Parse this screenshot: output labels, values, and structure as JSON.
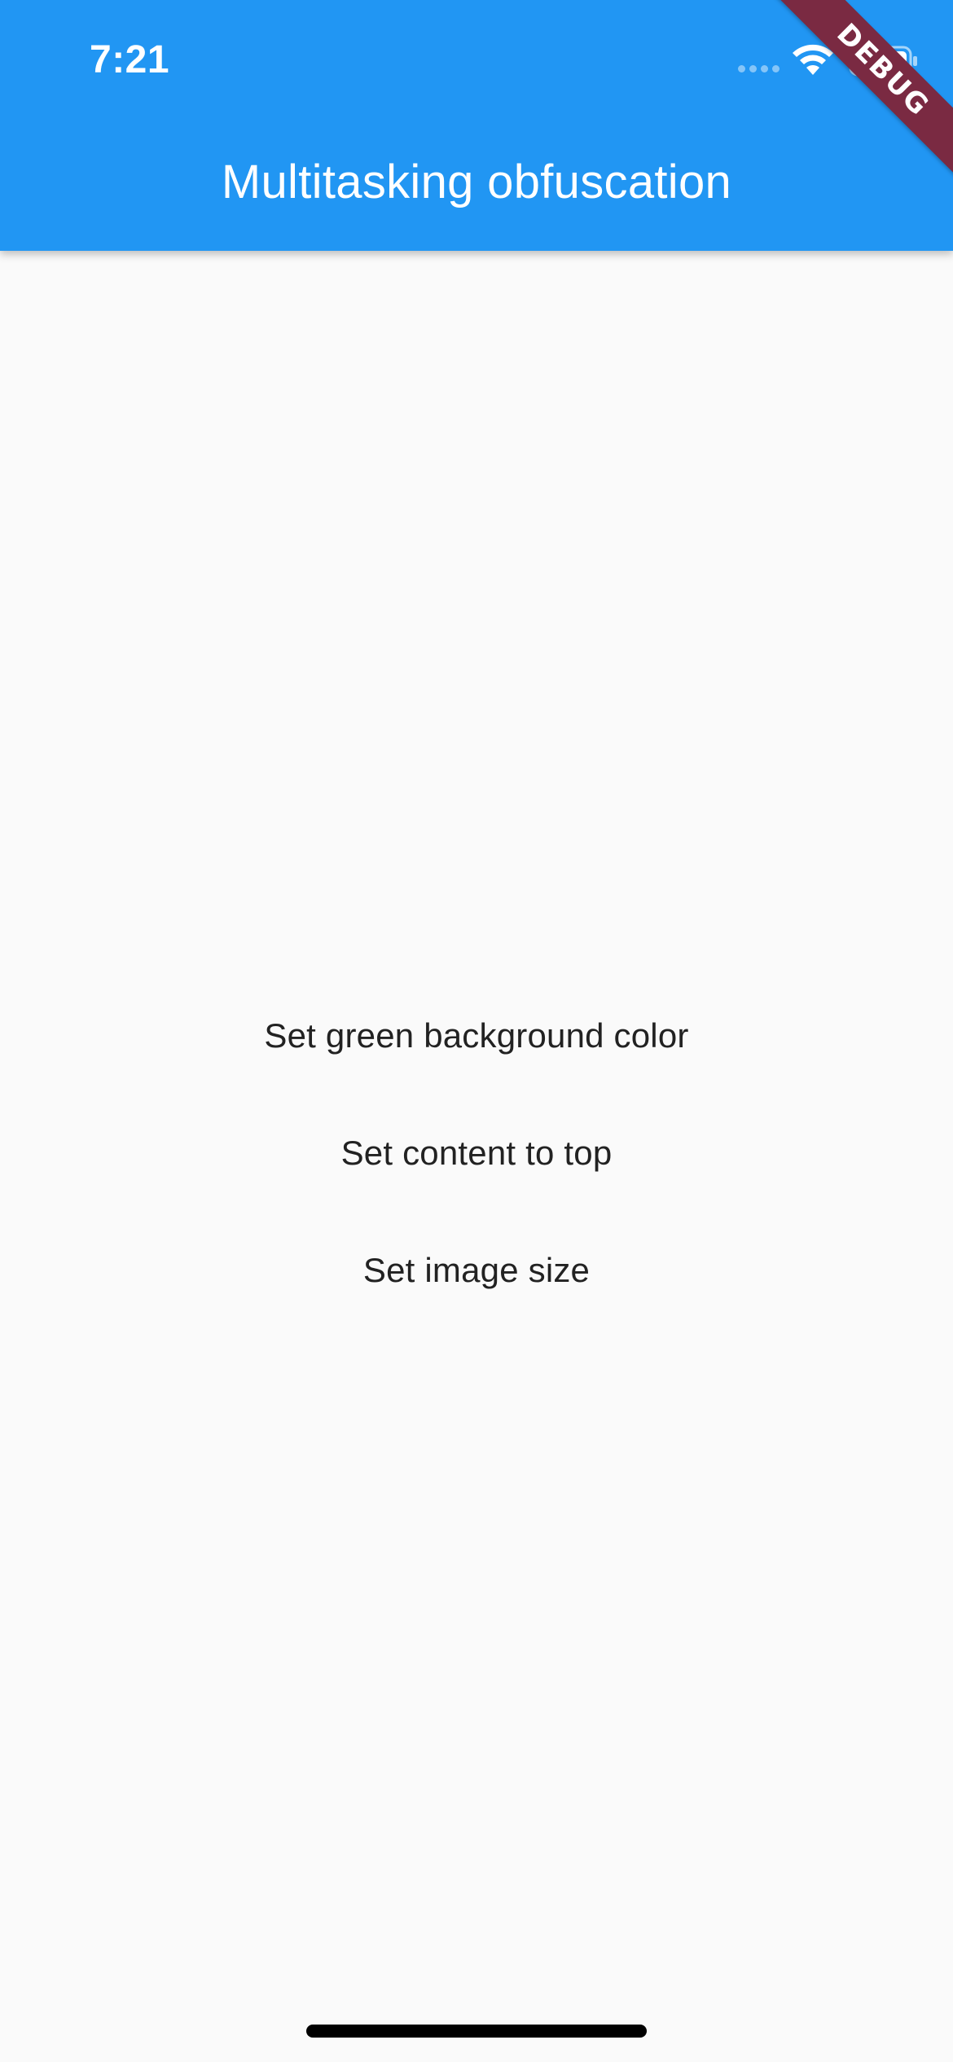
{
  "status_bar": {
    "time": "7:21",
    "icons": [
      "signal-dots-icon",
      "wifi-icon",
      "battery-icon"
    ]
  },
  "app_bar": {
    "title": "Multitasking obfuscation",
    "color": "#2196f3"
  },
  "debug_banner": {
    "label": "DEBUG",
    "color": "#7a2a42"
  },
  "actions": [
    {
      "label": "Set green background color"
    },
    {
      "label": "Set content to top"
    },
    {
      "label": "Set image size"
    }
  ],
  "background_color": "#fafafa"
}
